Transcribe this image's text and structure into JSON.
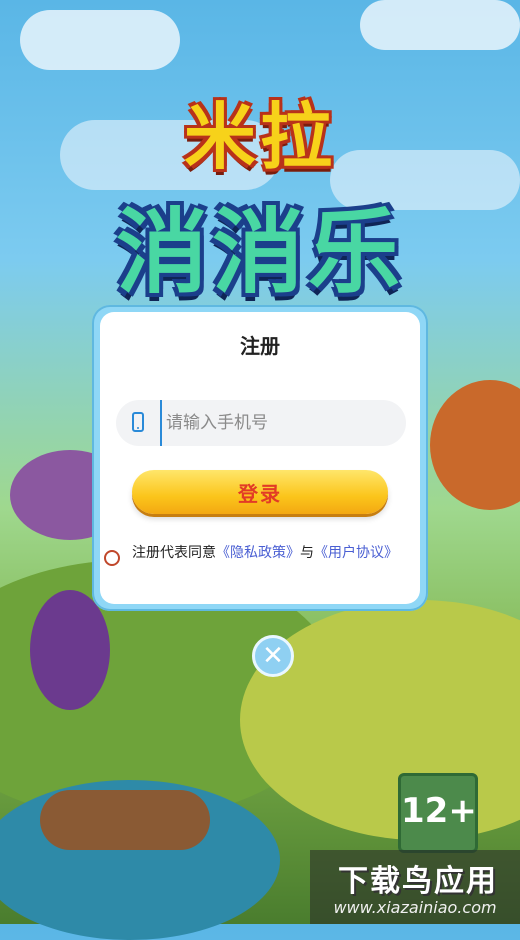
{
  "game": {
    "title_line1": "米拉",
    "title_line2": "消消乐"
  },
  "register_dialog": {
    "title": "注册",
    "phone_placeholder": "请输入手机号",
    "login_label": "登录",
    "agreement": {
      "prefix": "注册代表同意",
      "privacy_link": "《隐私政策》",
      "connector": "与",
      "terms_link": "《用户协议》"
    }
  },
  "close_button": {
    "icon": "close-icon"
  },
  "age_badge": {
    "label": "12+"
  },
  "watermark": {
    "title": "下载鸟应用",
    "url": "www.xiazainiao.com"
  }
}
